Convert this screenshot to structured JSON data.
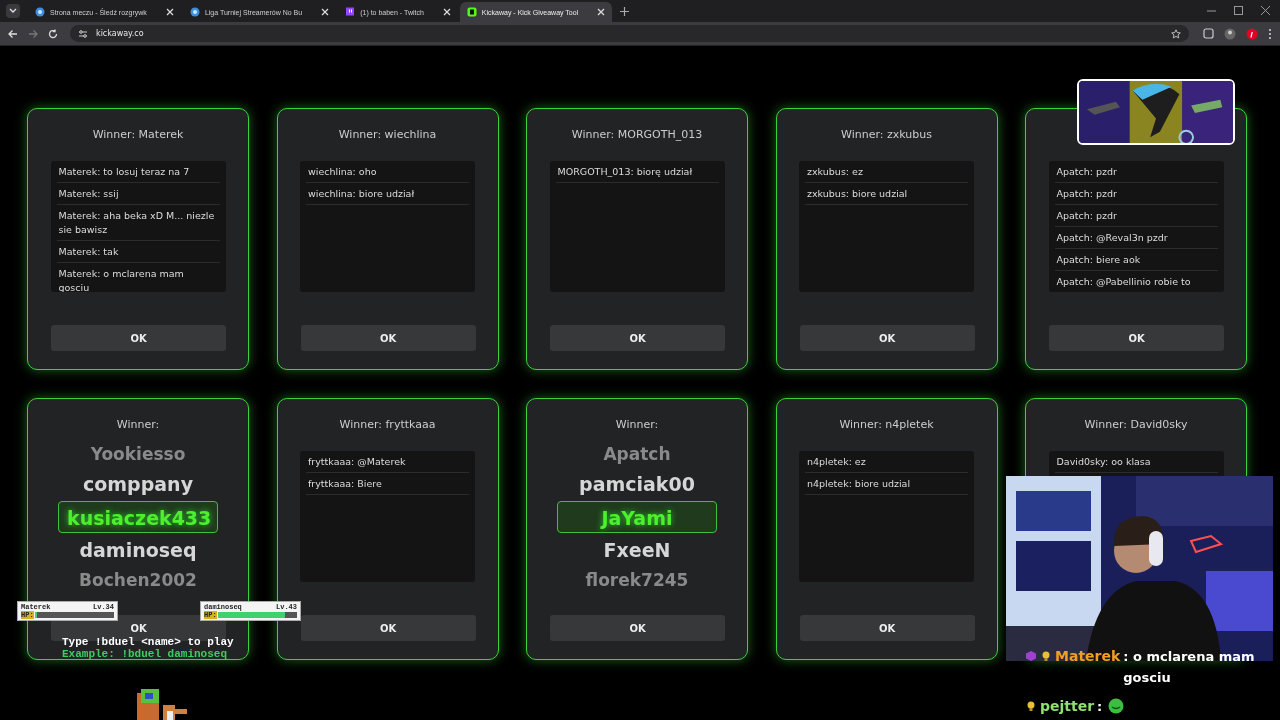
{
  "browser": {
    "tabs": [
      {
        "title": "Strona meczu - Śledź rozgrywk",
        "selected": false
      },
      {
        "title": "Liga Turniej Streamerów No Bu",
        "selected": false
      },
      {
        "title": "(1) to baben - Twitch",
        "selected": false
      },
      {
        "title": "Kickaway - Kick Giveaway Tool",
        "selected": true
      }
    ],
    "address": "kickaway.co"
  },
  "cards": [
    {
      "kind": "chat",
      "title": "Winner: Materek",
      "messages": [
        "Materek: to losuj teraz na 7",
        "Materek: ssij",
        "Materek: aha beka xD M... niezle sie bawisz",
        "Materek: tak",
        "Materek: o mclarena mam gosciu"
      ],
      "button": "OK"
    },
    {
      "kind": "chat",
      "title": "Winner: wiechlina",
      "messages": [
        "wiechlina: oho",
        "wiechlina: biore udział"
      ],
      "button": "OK"
    },
    {
      "kind": "chat",
      "title": "Winner: MORGOTH_013",
      "messages": [
        "MORGOTH_013: biorę udział"
      ],
      "button": "OK"
    },
    {
      "kind": "chat",
      "title": "Winner: zxkubus",
      "messages": [
        "zxkubus: ez",
        "zxkubus: biore udzial"
      ],
      "button": "OK"
    },
    {
      "kind": "chat",
      "messages": [
        "Apatch: pzdr",
        "Apatch: pzdr",
        "Apatch: pzdr",
        "Apatch: @Reval3n pzdr",
        "Apatch: biere aok",
        "Apatch: @Pabellinio robie to"
      ],
      "button": "OK"
    },
    {
      "kind": "roulette",
      "title": "Winner:",
      "names": [
        {
          "name": "Yookiesso",
          "selected": false
        },
        {
          "name": "comppany",
          "selected": false
        },
        {
          "name": "kusiaczek433",
          "selected": true
        },
        {
          "name": "daminoseq",
          "selected": false
        },
        {
          "name": "Bochen2002",
          "selected": false
        }
      ],
      "button": "OK"
    },
    {
      "kind": "chat",
      "title": "Winner: fryttkaaa",
      "messages": [
        "fryttkaaa: @Materek",
        "fryttkaaa: Biere"
      ],
      "button": "OK"
    },
    {
      "kind": "roulette",
      "title": "Winner:",
      "names": [
        {
          "name": "Apatch",
          "selected": false
        },
        {
          "name": "pamciak00",
          "selected": false
        },
        {
          "name": "JaYami",
          "selected": true
        },
        {
          "name": "FxeeN",
          "selected": false
        },
        {
          "name": "florek7245",
          "selected": false
        }
      ],
      "button": "OK"
    },
    {
      "kind": "chat",
      "title": "Winner: n4pletek",
      "messages": [
        "n4pletek: ez",
        "n4pletek: biore udzial"
      ],
      "button": "OK"
    },
    {
      "kind": "chat",
      "title": "Winner: David0sky",
      "messages": [
        "David0sky: oo klasa"
      ]
    }
  ],
  "game": {
    "players": [
      {
        "name": "Materek",
        "level_text": "Lv.34",
        "hp_label": "HP:",
        "level": 0.03
      },
      {
        "name": "daminoseq",
        "level_text": "Lv.43",
        "hp_label": "HP:",
        "level": 0.85
      }
    ],
    "instruction": "Type !bduel <name> to play",
    "example": "Example: !bduel daminoseq"
  },
  "stream_chat": [
    {
      "user": "Materek",
      "color": "#f0a020",
      "text": ": o mclarena mam gosciu",
      "sub_badge": true,
      "emote": false
    },
    {
      "user": "pejtter",
      "color": "#8fe070",
      "text": ":",
      "sub_badge": false,
      "emote": true
    }
  ]
}
